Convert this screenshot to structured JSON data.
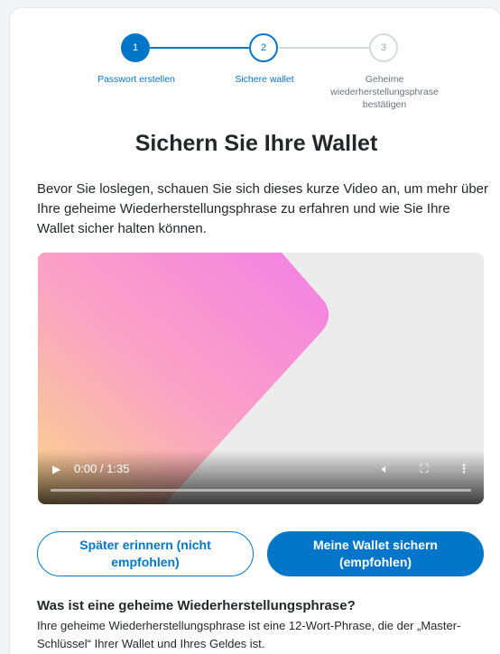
{
  "stepper": {
    "steps": [
      {
        "number": "1",
        "label": "Passwort erstellen"
      },
      {
        "number": "2",
        "label": "Sichere wallet"
      },
      {
        "number": "3",
        "label": "Geheime wiederherstellungsphrase bestätigen"
      }
    ]
  },
  "title": "Sichern Sie Ihre Wallet",
  "intro": "Bevor Sie loslegen, schauen Sie sich dieses kurze Video an, um mehr über Ihre geheime Wiederherstellungsphrase zu erfahren und wie Sie Ihre Wallet sicher halten können.",
  "video": {
    "time": "0:00 / 1:35",
    "progress": 0
  },
  "buttons": {
    "remind_later": "Später erinnern (nicht empfohlen)",
    "secure_wallet": "Meine Wallet sichern (empfohlen)"
  },
  "faq": {
    "title": "Was ist eine geheime Wiederherstellungsphrase?",
    "text": "Ihre geheime Wiederherstellungsphrase ist eine 12-Wort-Phrase, die der „Master-Schlüssel“ Ihrer Wallet und Ihres Geldes ist."
  },
  "colors": {
    "accent": "#0376c9",
    "inactive": "#d6d9dc"
  }
}
